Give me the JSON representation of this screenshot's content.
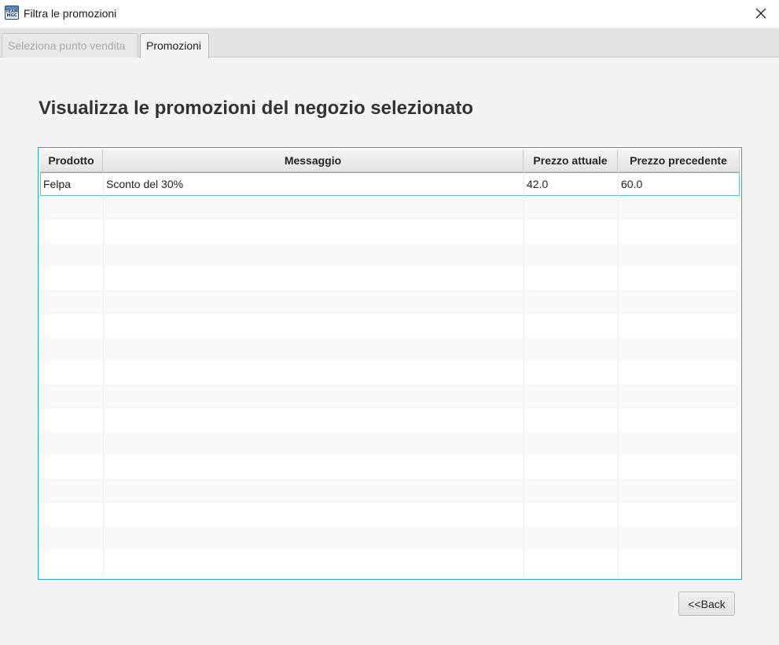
{
  "window": {
    "title": "Filtra le promozioni",
    "app_icon_text": "TEAM MGC",
    "close_icon": "close-icon"
  },
  "tabs": [
    {
      "label": "Seleziona punto vendita",
      "state": "inactive"
    },
    {
      "label": "Promozioni",
      "state": "active"
    }
  ],
  "main": {
    "heading": "Visualizza le promozioni del negozio selezionato",
    "back_label": "<<Back"
  },
  "table": {
    "columns": [
      "Prodotto",
      "Messaggio",
      "Prezzo attuale",
      "Prezzo precedente"
    ],
    "rows": [
      [
        "Felpa",
        "Sconto del 30%",
        "42.0",
        "60.0"
      ]
    ],
    "selected_row": 0,
    "empty_rows_visible": 16
  },
  "colors": {
    "table_focus_border": "#2aa3dc",
    "selection_border": "#5fb6e4",
    "window_background": "#f4f4f4"
  }
}
